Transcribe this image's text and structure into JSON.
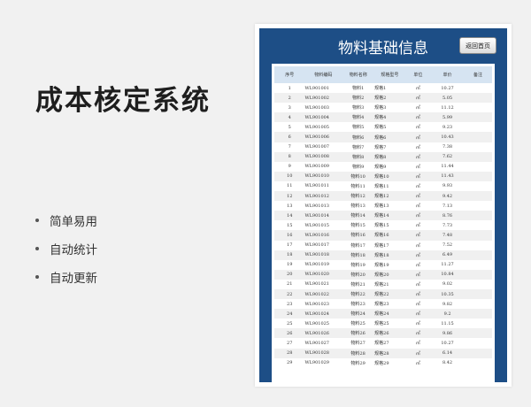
{
  "hero": {
    "title": "成本核定系统",
    "features": [
      "简单易用",
      "自动统计",
      "自动更新"
    ]
  },
  "sheet": {
    "title": "物料基础信息",
    "back_button": "返回首页",
    "columns": [
      "序号",
      "物料编码",
      "物料名称",
      "规格型号",
      "单位",
      "单价",
      "备注"
    ],
    "rows": [
      [
        "1",
        "WL901001",
        "物料1",
        "规格1",
        "㎡",
        "10.27",
        ""
      ],
      [
        "2",
        "WL901002",
        "物料2",
        "规格2",
        "㎡",
        "5.05",
        ""
      ],
      [
        "3",
        "WL901003",
        "物料3",
        "规格3",
        "㎡",
        "11.12",
        ""
      ],
      [
        "4",
        "WL901004",
        "物料4",
        "规格4",
        "㎡",
        "5.99",
        ""
      ],
      [
        "5",
        "WL901005",
        "物料5",
        "规格5",
        "㎡",
        "9.23",
        ""
      ],
      [
        "6",
        "WL901006",
        "物料6",
        "规格6",
        "㎡",
        "10.43",
        ""
      ],
      [
        "7",
        "WL901007",
        "物料7",
        "规格7",
        "㎡",
        "7.38",
        ""
      ],
      [
        "8",
        "WL901008",
        "物料8",
        "规格8",
        "㎡",
        "7.62",
        ""
      ],
      [
        "9",
        "WL901009",
        "物料9",
        "规格9",
        "㎡",
        "11.44",
        ""
      ],
      [
        "10",
        "WL901010",
        "物料10",
        "规格10",
        "㎡",
        "11.43",
        ""
      ],
      [
        "11",
        "WL901011",
        "物料11",
        "规格11",
        "㎡",
        "9.93",
        ""
      ],
      [
        "12",
        "WL901012",
        "物料12",
        "规格12",
        "㎡",
        "9.42",
        ""
      ],
      [
        "13",
        "WL901013",
        "物料13",
        "规格13",
        "㎡",
        "7.13",
        ""
      ],
      [
        "14",
        "WL901014",
        "物料14",
        "规格14",
        "㎡",
        "8.76",
        ""
      ],
      [
        "15",
        "WL901015",
        "物料15",
        "规格15",
        "㎡",
        "7.73",
        ""
      ],
      [
        "16",
        "WL901016",
        "物料16",
        "规格16",
        "㎡",
        "7.48",
        ""
      ],
      [
        "17",
        "WL901017",
        "物料17",
        "规格17",
        "㎡",
        "7.52",
        ""
      ],
      [
        "18",
        "WL901018",
        "物料18",
        "规格18",
        "㎡",
        "6.49",
        ""
      ],
      [
        "19",
        "WL901019",
        "物料19",
        "规格19",
        "㎡",
        "11.27",
        ""
      ],
      [
        "20",
        "WL901020",
        "物料20",
        "规格20",
        "㎡",
        "10.84",
        ""
      ],
      [
        "21",
        "WL901021",
        "物料21",
        "规格21",
        "㎡",
        "9.02",
        ""
      ],
      [
        "22",
        "WL901022",
        "物料22",
        "规格22",
        "㎡",
        "10.35",
        ""
      ],
      [
        "23",
        "WL901023",
        "物料23",
        "规格23",
        "㎡",
        "9.82",
        ""
      ],
      [
        "24",
        "WL901024",
        "物料24",
        "规格24",
        "㎡",
        "9.2",
        ""
      ],
      [
        "25",
        "WL901025",
        "物料25",
        "规格25",
        "㎡",
        "11.15",
        ""
      ],
      [
        "26",
        "WL901026",
        "物料26",
        "规格26",
        "㎡",
        "9.86",
        ""
      ],
      [
        "27",
        "WL901027",
        "物料27",
        "规格27",
        "㎡",
        "10.27",
        ""
      ],
      [
        "28",
        "WL901028",
        "物料28",
        "规格28",
        "㎡",
        "6.14",
        ""
      ],
      [
        "29",
        "WL901029",
        "物料29",
        "规格29",
        "㎡",
        "8.42",
        ""
      ]
    ]
  },
  "colors": {
    "page_background": "#f1f1f1",
    "sheet_frame": "#1d4e86",
    "header_row": "#d6e4f2",
    "striped_row": "#f0f0f0"
  }
}
